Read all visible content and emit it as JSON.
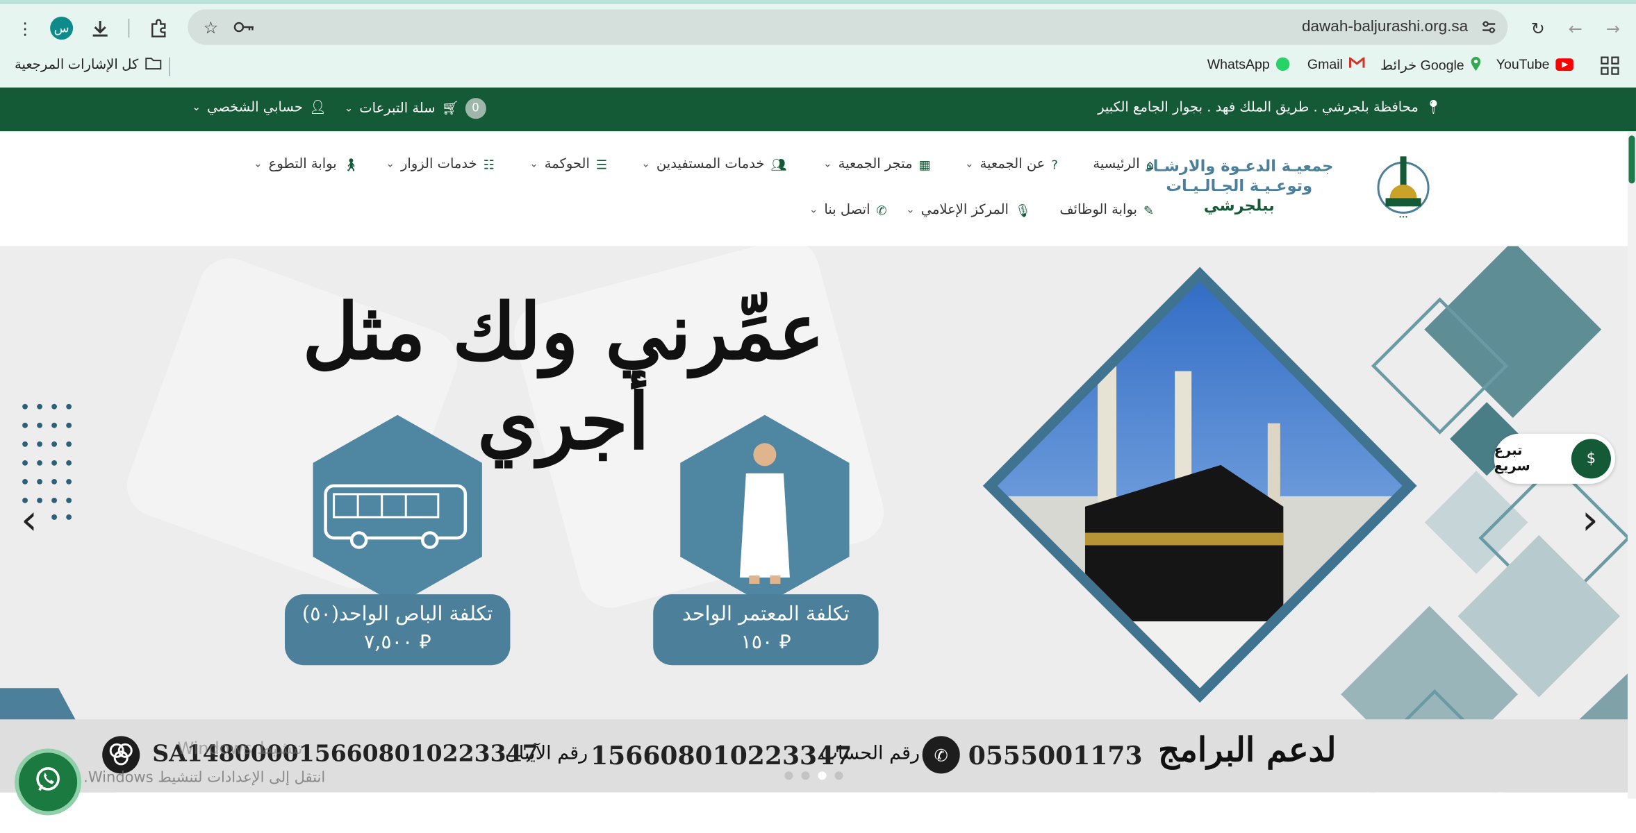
{
  "browser": {
    "url": "dawah-baljurashi.org.sa",
    "profile_initial": "س",
    "bookmarks_all": "كل الإشارات المرجعية",
    "bookmarks": [
      "WhatsApp",
      "Gmail",
      "خرائط Google",
      "YouTube"
    ]
  },
  "topbar": {
    "location": "محافظة بلجرشي . طريق الملك فهد . بجوار الجامع الكبير",
    "cart_label": "سلة التبرعات",
    "cart_count": "0",
    "account": "حسابي الشخصي"
  },
  "logo": {
    "line1": "جمعيـة الدعـوة والارشـاد",
    "line2": "وتوعـيـة الجـالـيـات",
    "line3": "ببلجرشي"
  },
  "nav_row1": [
    "الرئيسية",
    "عن الجمعية",
    "متجر الجمعية",
    "خدمات المستفيدين",
    "الحوكمة",
    "خدمات الزوار",
    "بوابة التطوع"
  ],
  "nav_row2": [
    "بوابة الوظائف",
    "المركز الإعلامي",
    "اتصل بنا"
  ],
  "hero": {
    "headline": "عمِّرني ولك مثل أجري",
    "card1_title": "تكلفة المعتمر الواحد",
    "card1_value": "١٥٠ ⃁",
    "card2_title": "تكلفة الباص الواحد(٥٠)",
    "card2_value": "٧,٥٠٠ ⃁",
    "quick_donate": "تبرع سريع",
    "support_label": "لدعم البرامج",
    "phone": "0555001173",
    "account_label": "رقم الحساب",
    "account_number": "156608010223347",
    "iban_label": "رقم الآيبان",
    "iban": "SA1480000156608010223347",
    "watermark1": "تنشيط Windows",
    "watermark2": "انتقل إلى الإعدادات لتنشيط Windows."
  },
  "colors": {
    "brand_green": "#145a36",
    "slate_blue": "#4b7f9a"
  }
}
